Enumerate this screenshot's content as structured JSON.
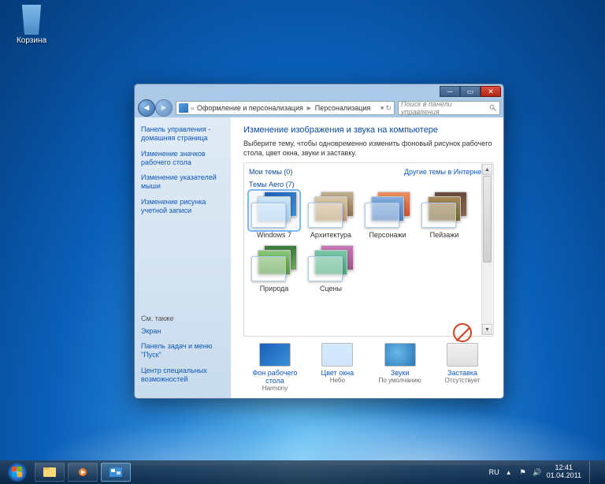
{
  "desktop": {
    "recycle_bin": "Корзина"
  },
  "window": {
    "breadcrumb": {
      "a": "Оформление и персонализация",
      "b": "Персонализация"
    },
    "search_placeholder": "Поиск в панели управления",
    "heading": "Изменение изображения и звука на компьютере",
    "subtext": "Выберите тему, чтобы одновременно изменить фоновый рисунок рабочего стола, цвет окна, звуки и заставку.",
    "my_themes_label": "Мои темы (0)",
    "online_link": "Другие темы в Интернете",
    "aero_label": "Темы Aero (7)",
    "themes": [
      {
        "label": "Windows 7",
        "c1": "linear-gradient(135deg,#1a5fb8,#3a8fd8)",
        "c2": "linear-gradient(#cde6fa,#a8d0f0)",
        "selected": true
      },
      {
        "label": "Архитектура",
        "c1": "linear-gradient(#c0b090,#907050)",
        "c2": "linear-gradient(#d8c8a8,#b89868)"
      },
      {
        "label": "Персонажи",
        "c1": "linear-gradient(#f09060,#d05030)",
        "c2": "linear-gradient(#80b0e0,#5080c0)"
      },
      {
        "label": "Пейзажи",
        "c1": "linear-gradient(#6a4a3a,#8a6a4a)",
        "c2": "linear-gradient(#a88858,#786838)"
      },
      {
        "label": "Природа",
        "c1": "linear-gradient(#3a7a3a,#6aaa5a)",
        "c2": "linear-gradient(#8ac878,#5a9848)"
      },
      {
        "label": "Сцены",
        "c1": "linear-gradient(#c878b8,#985888)",
        "c2": "linear-gradient(#78c8a8,#48a878)"
      }
    ],
    "footer": [
      {
        "label": "Фон рабочего стола",
        "value": "Harmony",
        "bg": "linear-gradient(135deg,#1a5fb8,#3a8fd8)"
      },
      {
        "label": "Цвет окна",
        "value": "Небо",
        "bg": "linear-gradient(rgba(180,220,250,.6),rgba(140,190,240,.4))"
      },
      {
        "label": "Звуки",
        "value": "По умолчанию",
        "bg": "radial-gradient(circle at 40% 40%,#6ab8e8,#2a78b8)"
      },
      {
        "label": "Заставка",
        "value": "Отсутствует",
        "bg": "linear-gradient(#f0f0f0,#e0e0e0)"
      }
    ]
  },
  "sidebar": {
    "links": [
      "Панель управления - домашняя страница",
      "Изменение значков рабочего стола",
      "Изменение указателей мыши",
      "Изменение рисунка учетной записи"
    ],
    "also_label": "См. также",
    "also": [
      "Экран",
      "Панель задач и меню \"Пуск\"",
      "Центр специальных возможностей"
    ]
  },
  "taskbar": {
    "lang": "RU",
    "time": "12:41",
    "date": "01.04.2011"
  }
}
